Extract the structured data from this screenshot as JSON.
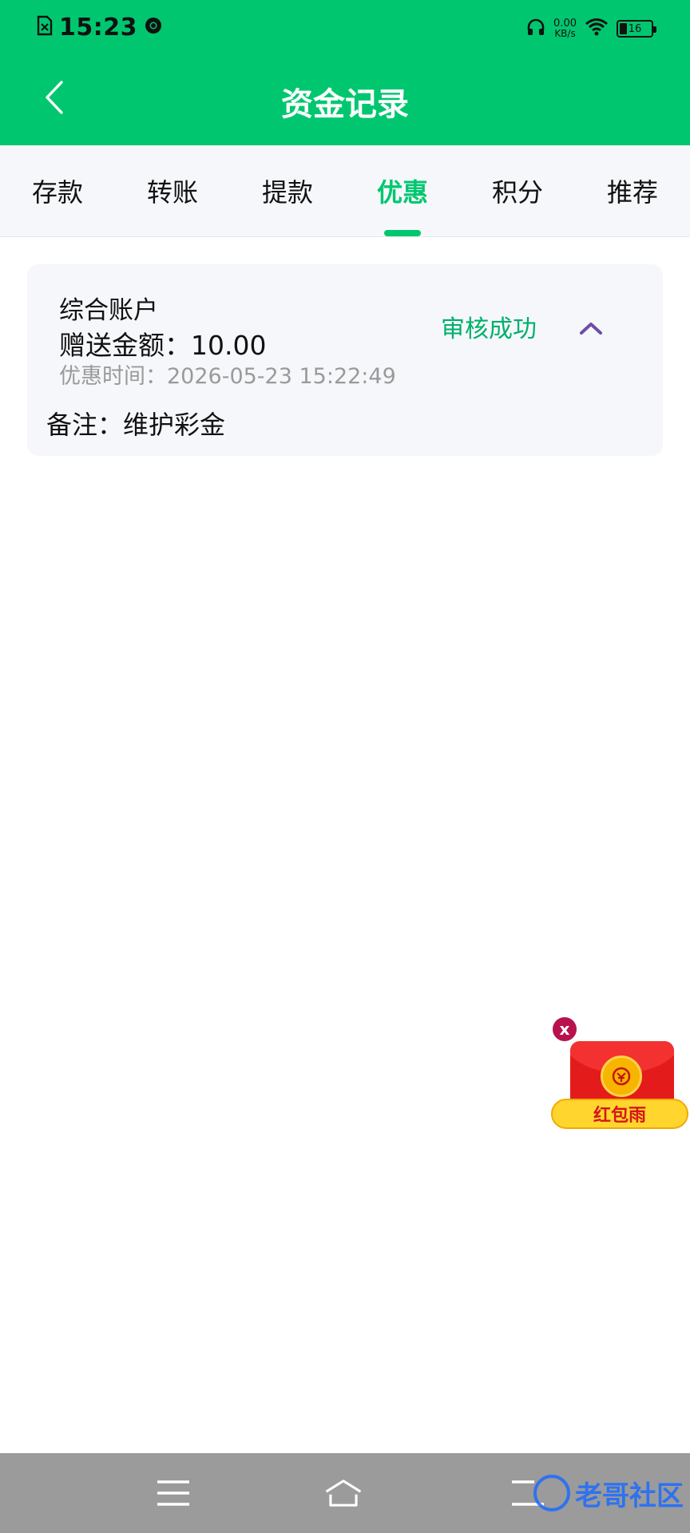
{
  "status_bar": {
    "time": "15:23",
    "net_speed_value": "0.00",
    "net_speed_unit": "KB/s",
    "battery_level": "16"
  },
  "header": {
    "title": "资金记录"
  },
  "tabs": [
    {
      "label": "存款",
      "active": false
    },
    {
      "label": "转账",
      "active": false
    },
    {
      "label": "提款",
      "active": false
    },
    {
      "label": "优惠",
      "active": true
    },
    {
      "label": "积分",
      "active": false
    },
    {
      "label": "推荐",
      "active": false
    }
  ],
  "record": {
    "account_name": "综合账户",
    "amount_label": "赠送金额：",
    "amount_value": "10.00",
    "time_label": "优惠时间：",
    "time_value": "2026-05-23 15:22:49",
    "status": "审核成功",
    "remark_label": "备注：",
    "remark_value": "维护彩金"
  },
  "red_packet": {
    "close_label": "x",
    "label": "红包雨"
  },
  "watermark": {
    "text": "老哥社区"
  },
  "colors": {
    "brand_green": "#00C76F",
    "status_green": "#00B06A",
    "collapse_purple": "#6B4FA8"
  }
}
